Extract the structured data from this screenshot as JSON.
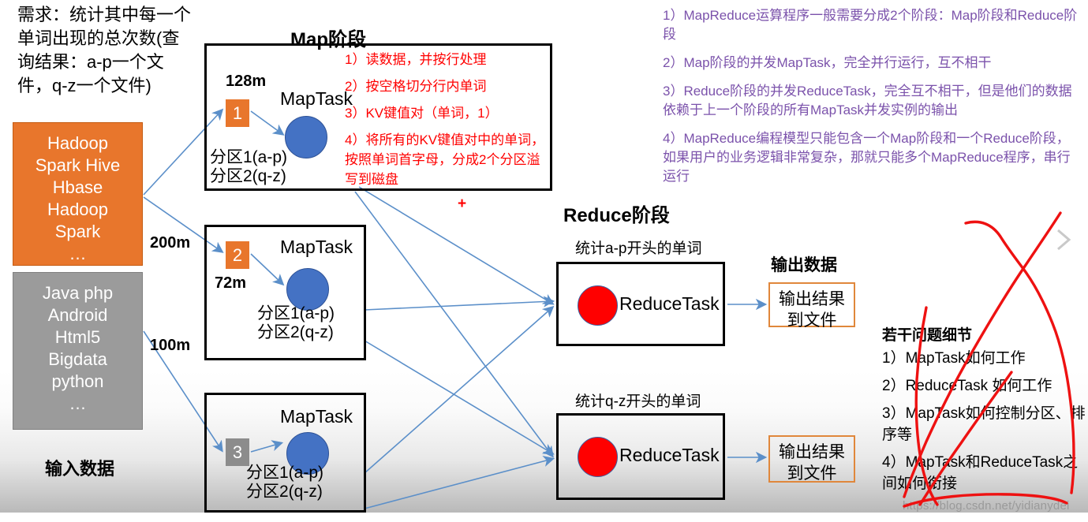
{
  "requirement": {
    "text": "需求：统计其中每一个单词出现的总次数(查询结果：a-p一个文件，q-z一个文件)"
  },
  "input": {
    "label": "输入数据",
    "sources": [
      {
        "name": "source-orange",
        "text": "Hadoop\nSpark Hive\nHbase\nHadoop\nSpark\n…",
        "color": "#E8762C"
      },
      {
        "name": "source-gray",
        "text": "Java php\nAndroid\nHtml5\nBigdata\npython\n…",
        "color": "#9B9B9B"
      }
    ],
    "sizes": {
      "s128": "128m",
      "s200": "200m",
      "s72": "72m",
      "s100": "100m"
    }
  },
  "map_stage": {
    "title": "Map阶段",
    "tasks": [
      {
        "chunk": "1",
        "chunk_color": "#E8762C",
        "task_label": "MapTask",
        "partitions": "分区1(a-p)\n分区2(q-z)"
      },
      {
        "chunk": "2",
        "chunk_color": "#E8762C",
        "task_label": "MapTask",
        "partitions": "分区1(a-p)\n分区2(q-z)"
      },
      {
        "chunk": "3",
        "chunk_color": "#8C8C8C",
        "task_label": "MapTask",
        "partitions": "分区1(a-p)\n分区2(q-z)"
      }
    ],
    "steps": [
      "1）读数据，并按行处理",
      "2）按空格切分行内单词",
      "3）KV键值对（单词，1）",
      "4）将所有的KV键值对中的单词，按照单词首字母，分成2个分区溢写到磁盘"
    ],
    "plus_marker": "+",
    "step_color": "#FF0000"
  },
  "reduce_stage": {
    "title": "Reduce阶段",
    "tasks": [
      {
        "caption": "统计a-p开头的单词",
        "task_label": "ReduceTask"
      },
      {
        "caption": "统计q-z开头的单词",
        "task_label": "ReduceTask"
      }
    ],
    "output": {
      "title": "输出数据",
      "boxes": [
        "输出结果\n到文件",
        "输出结果\n到文件"
      ],
      "border_color": "#E0873B"
    }
  },
  "notes": {
    "color": "#7B52AB",
    "items": [
      "1）MapReduce运算程序一般需要分成2个阶段：Map阶段和Reduce阶段",
      "2）Map阶段的并发MapTask，完全并行运行，互不相干",
      "3）Reduce阶段的并发ReduceTask，完全互不相干，但是他们的数据依赖于上一个阶段的所有MapTask并发实例的输出",
      "4）MapReduce编程模型只能包含一个Map阶段和一个Reduce阶段，如果用户的业务逻辑非常复杂，那就只能多个MapReduce程序，串行运行"
    ]
  },
  "details": {
    "title": "若干问题细节",
    "items": [
      "1）MapTask如何工作",
      "2）ReduceTask 如何工作",
      "3）MapTask如何控制分区、排序等",
      "4）MapTask和ReduceTask之间如何衔接"
    ]
  },
  "annotations": {
    "scribble_color": "#EE1111",
    "cursor_icon": "chevron-right-icon"
  },
  "watermark": "https://blog.csdn.net/yidianydei"
}
